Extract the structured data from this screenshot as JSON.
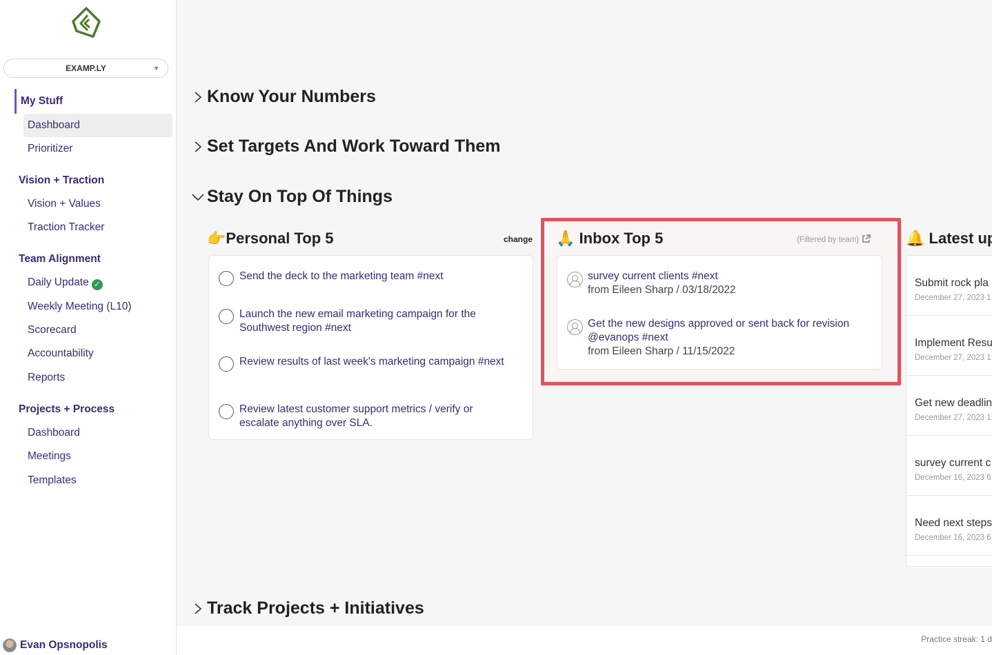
{
  "org": {
    "name": "EXAMP.LY"
  },
  "sidebar": {
    "my_stuff": "My Stuff",
    "dashboard": "Dashboard",
    "prioritizer": "Prioritizer",
    "vision_traction": "Vision + Traction",
    "vision_values": "Vision + Values",
    "traction_tracker": "Traction Tracker",
    "team_alignment": "Team Alignment",
    "daily_update": "Daily Update",
    "weekly_meeting": "Weekly Meeting (L10)",
    "scorecard": "Scorecard",
    "accountability": "Accountability",
    "reports": "Reports",
    "projects_process": "Projects + Process",
    "pp_dashboard": "Dashboard",
    "meetings": "Meetings",
    "templates": "Templates"
  },
  "user": {
    "name": "Evan Opsnopolis"
  },
  "sections": {
    "know_numbers": "Know Your Numbers",
    "set_targets": "Set Targets And Work Toward Them",
    "stay_on_top": "Stay On Top Of Things",
    "track_projects": "Track Projects + Initiatives"
  },
  "personal_top5": {
    "emoji": "👉",
    "title": "Personal Top 5",
    "change_label": "change",
    "tasks": [
      "Send the deck to the marketing team #next",
      "Launch the new email marketing campaign for the Southwest region #next",
      "Review results of last week's marketing campaign #next",
      "Review latest customer support metrics / verify or escalate anything over SLA."
    ]
  },
  "inbox_top5": {
    "emoji": "🙏",
    "title": "Inbox Top 5",
    "filter_note": "(Filtered by team)",
    "items": [
      {
        "text": "survey current clients #next",
        "from": "from Eileen Sharp / 03/18/2022"
      },
      {
        "text": "Get the new designs approved or sent back for revision @evanops #next",
        "from": "from Eileen Sharp / 11/15/2022"
      }
    ]
  },
  "latest_updates": {
    "emoji": "🔔",
    "title": "Latest up",
    "items": [
      {
        "title": "Submit rock pla",
        "date": "December 27, 2023 1:"
      },
      {
        "title": "Implement Resu",
        "date": "December 27, 2023 1:"
      },
      {
        "title": "Get new deadlin",
        "date": "December 27, 2023 1:"
      },
      {
        "title": "survey current c",
        "date": "December 16, 2023 6:"
      },
      {
        "title": "Need next steps",
        "date": "December 16, 2023 6:"
      }
    ]
  },
  "footer": {
    "streak": "Practice streak: 1 d"
  },
  "colors": {
    "accent": "#6a55d8",
    "nav_text": "#3b2a73",
    "highlight": "#e0535d",
    "success": "#2e9c4f"
  },
  "icons": [
    "logo-icon",
    "chevron-down-icon",
    "chevron-right-icon",
    "check-circle-icon",
    "external-link-icon",
    "user-icon",
    "bell-icon"
  ]
}
